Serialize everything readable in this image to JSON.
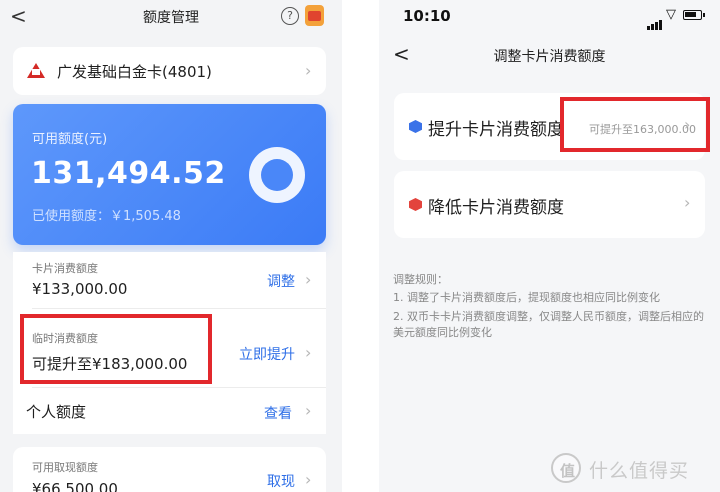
{
  "left": {
    "header": {
      "back": "<",
      "title": "额度管理",
      "help": "?"
    },
    "bank": {
      "name": "广发基础白金卡(4801)"
    },
    "summary": {
      "available_label": "可用额度(元)",
      "available_amount": "131,494.52",
      "used_label": "已使用额度：￥1,505.48"
    },
    "rows": [
      {
        "sublabel": "卡片消费额度",
        "value": "¥133,000.00",
        "action": "调整"
      },
      {
        "sublabel": "临时消费额度",
        "value": "可提升至¥183,000.00",
        "action": "立即提升"
      },
      {
        "value": "个人额度",
        "action": "查看"
      }
    ],
    "cash": {
      "sublabel": "可用取现额度",
      "value": "¥66,500.00",
      "action": "取现"
    }
  },
  "right": {
    "status": {
      "time": "10:10"
    },
    "header": {
      "back": "<",
      "title": "调整卡片消费额度"
    },
    "options": [
      {
        "label": "提升卡片消费额度",
        "hint": "可提升至163,000.00"
      },
      {
        "label": "降低卡片消费额度"
      }
    ],
    "rules": {
      "title": "调整规则：",
      "lines": [
        "1. 调整了卡片消费额度后，提现额度也相应同比例变化",
        "2. 双币卡卡片消费额度调整，仅调整人民币额度，调整后相应的美元额度同比例变化"
      ]
    }
  },
  "watermark": {
    "logo_char": "值",
    "text": "什么值得买"
  },
  "colors": {
    "accent": "#3b7bf6",
    "highlight_box": "#e2282c",
    "link": "#2f6fe7"
  }
}
